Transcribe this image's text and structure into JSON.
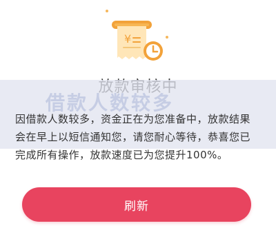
{
  "status": {
    "title": "放款审核中",
    "description": "因借款人数较多，资金正在为您准备中，放款结果会在早上以短信通知您，请您耐心等待，恭喜您已完成所有操作，放款速度已为您提升100%。",
    "icon": "loan-pending-icon"
  },
  "watermark": {
    "text": "借款人数较多"
  },
  "actions": {
    "refresh_label": "刷新"
  },
  "colors": {
    "accent": "#e8445f",
    "icon_orange": "#f2a23a",
    "icon_light": "#ffe6b8",
    "title_text": "#2a2a2a",
    "body_text": "#333333"
  }
}
